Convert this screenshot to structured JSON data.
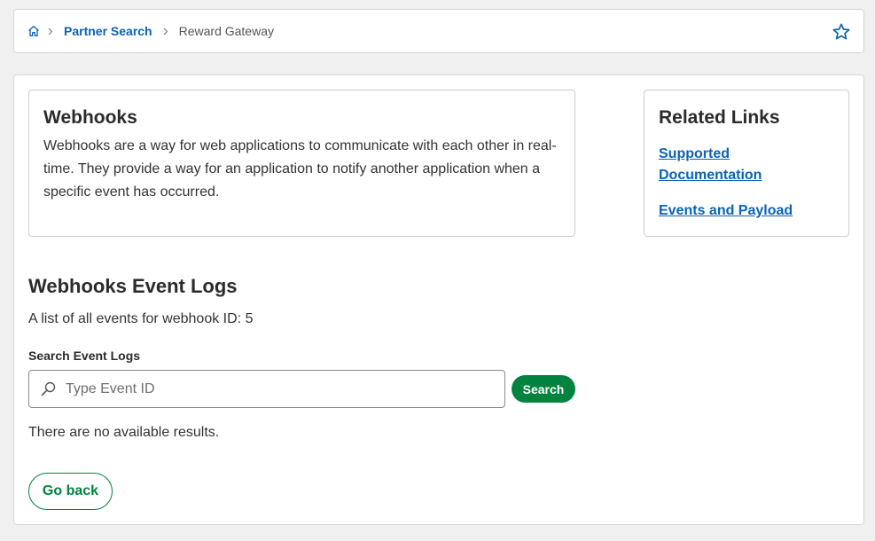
{
  "breadcrumb": {
    "home_icon": "home-icon",
    "items": [
      {
        "label": "Partner Search"
      },
      {
        "label": "Reward Gateway"
      }
    ],
    "favorite_icon": "star-icon"
  },
  "webhooks_card": {
    "title": "Webhooks",
    "description": "Webhooks are a way for web applications to communicate with each other in real-time. They provide a way for an application to notify another application when a specific event has occurred."
  },
  "related_links": {
    "title": "Related Links",
    "links": [
      {
        "label": "Supported Documentation"
      },
      {
        "label": "Events and Payload"
      }
    ]
  },
  "event_logs": {
    "title": "Webhooks Event Logs",
    "description": "A list of all events for webhook ID: 5",
    "search_label": "Search Event Logs",
    "search_placeholder": "Type Event ID",
    "search_value": "",
    "search_button": "Search",
    "empty_message": "There are no available results.",
    "back_button": "Go back"
  },
  "colors": {
    "link_blue": "#0b63b3",
    "primary_green": "#00833e",
    "background": "#f0f0f0"
  }
}
